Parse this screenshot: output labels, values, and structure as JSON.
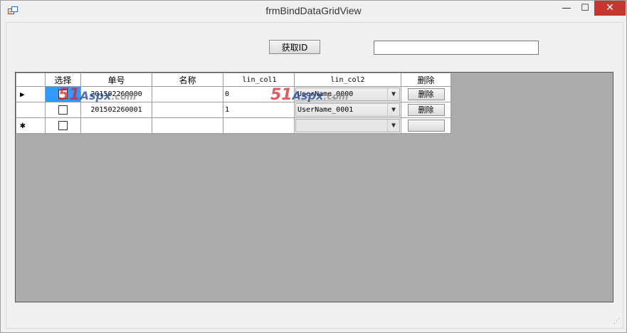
{
  "window": {
    "title": "frmBindDataGridView",
    "icon": "app-form-icon",
    "controls": {
      "minimize": "—",
      "maximize": "☐",
      "close": "✕"
    }
  },
  "toolbar": {
    "get_id_label": "获取ID",
    "id_value": ""
  },
  "grid": {
    "headers": {
      "select": "选择",
      "number": "单号",
      "name": "名称",
      "col1": "lin_col1",
      "col2": "lin_col2",
      "delete": "删除"
    },
    "rows": [
      {
        "indicator": "▶",
        "number": "201502260000",
        "name": "",
        "col1": "0",
        "col2": "UserName_0000",
        "delete": "删除",
        "checked": false
      },
      {
        "indicator": "",
        "number": "201502260001",
        "name": "",
        "col1": "1",
        "col2": "UserName_0001",
        "delete": "删除",
        "checked": false
      }
    ],
    "new_row": {
      "indicator": "✱",
      "number": "",
      "name": "",
      "col1": "",
      "col2": "",
      "delete": ""
    }
  },
  "watermark": {
    "part1": "51",
    "part2": "Aspx",
    "part3": ".com"
  },
  "colors": {
    "selection": "#3399ff",
    "grid_background": "#ababab",
    "close_button": "#c7372f"
  }
}
